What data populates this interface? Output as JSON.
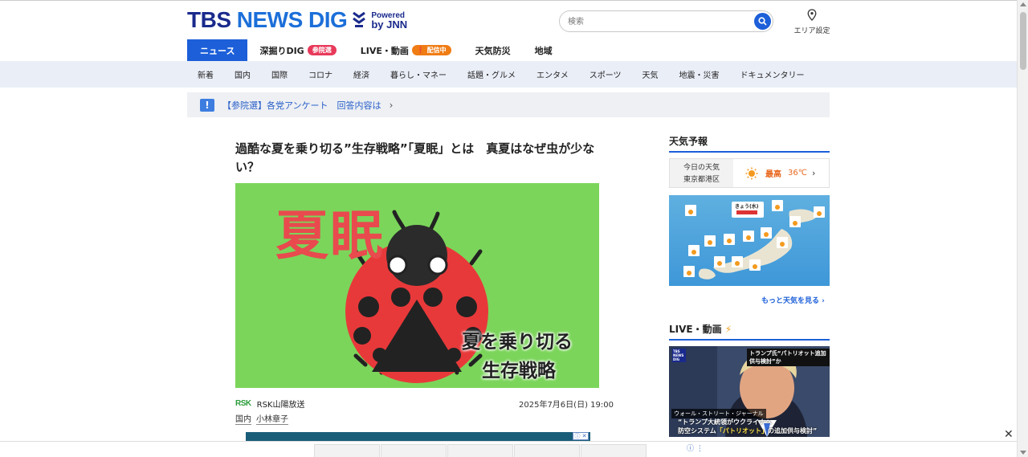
{
  "header": {
    "logo_text_a": "TBS",
    "logo_text_b": "NEWS DIG",
    "powered_line1": "Powered",
    "powered_line2": "by JNN",
    "search_placeholder": "検索",
    "area_label": "エリア設定"
  },
  "nav_primary": [
    {
      "label": "ニュース",
      "badge": ""
    },
    {
      "label": "深掘りDIG",
      "badge": "参院選"
    },
    {
      "label": "LIVE・動画",
      "badge": "配信中"
    },
    {
      "label": "天気防災",
      "badge": ""
    },
    {
      "label": "地域",
      "badge": ""
    }
  ],
  "nav_secondary": [
    "新着",
    "国内",
    "国際",
    "コロナ",
    "経済",
    "暮らし・マネー",
    "話題・グルメ",
    "エンタメ",
    "スポーツ",
    "天気",
    "地震・災害",
    "ドキュメンタリー"
  ],
  "notice": {
    "icon": "!",
    "text": "【参院選】各党アンケート　回答内容は",
    "arrow": "›"
  },
  "article": {
    "title": "過酷な夏を乗り切る”生存戦略”「夏眠」とは　真夏はなぜ虫が少ない？",
    "image_kanji": "夏眠",
    "image_caption_1": "夏を乗り切る",
    "image_caption_2": "生存戦略",
    "source_logo": "RSK",
    "source_name": "RSK山陽放送",
    "date": "2025年7月6日(日) 19:00",
    "tags": [
      "国内",
      "小林章子"
    ]
  },
  "sidebar": {
    "weather_heading": "天気予報",
    "weather_today": "今日の天気",
    "weather_location": "東京都港区",
    "weather_high_label": "最高",
    "weather_high_temp": "36℃",
    "more_weather": "もっと天気を見る ›",
    "live_heading": "LIVE・動画",
    "video_caption_top": "トランプ氏“パトリオット追加供与検討”か",
    "video_caption_source": "ウォール・ストリート・ジャーナル",
    "video_caption_line1": "“トランプ大統領がウクライナへ",
    "video_caption_line2a": "防空システム",
    "video_caption_line2b": "「パトリオット」",
    "video_caption_line2c": "の追加供与検討”"
  },
  "colors": {
    "brand": "#1c5fd9",
    "brand_dark": "#1a2a8c",
    "badge_red": "#e8395a",
    "badge_orange": "#f07c14",
    "image_bg": "#7bd55a",
    "ladybug_red": "#e8393a"
  }
}
